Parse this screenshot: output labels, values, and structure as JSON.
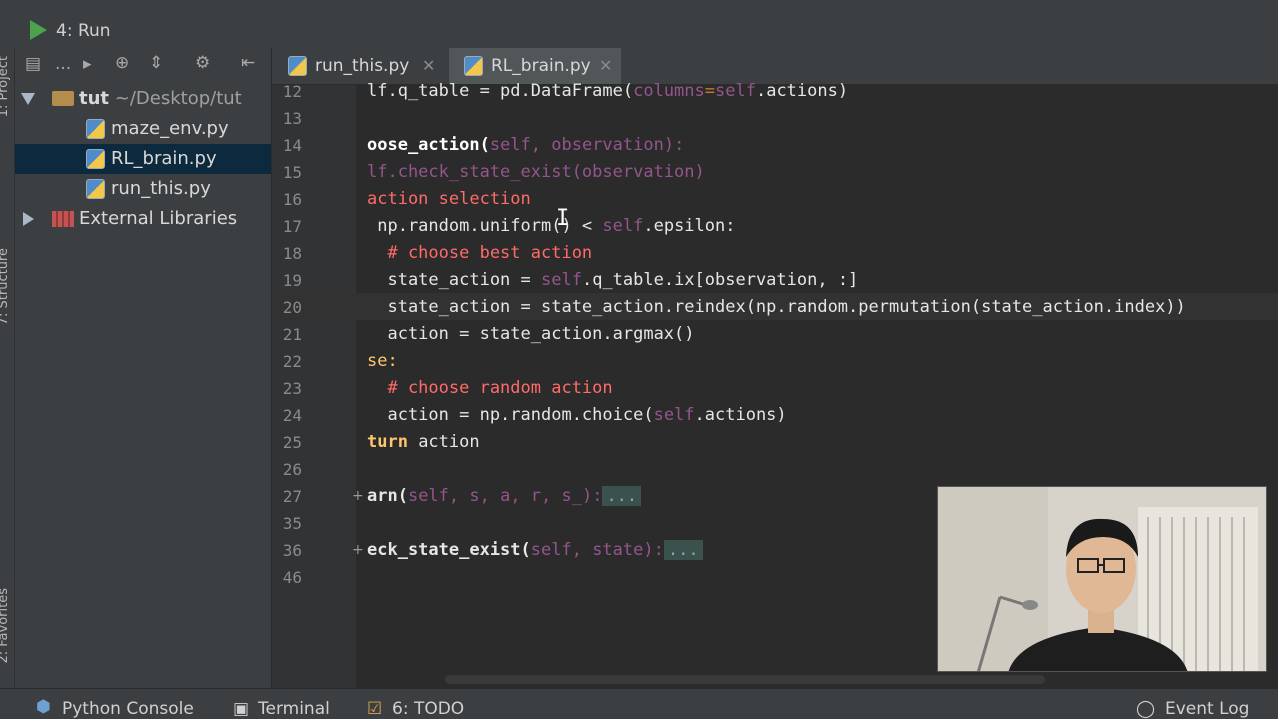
{
  "run_toolbar": {
    "label": "4: Run"
  },
  "side_strip": {
    "project_label": "1: Project",
    "structure_label": "7: Structure",
    "favorites_label": "2: Favorites"
  },
  "project_panel": {
    "toolbar_dots": "...",
    "tree": [
      {
        "name": "tut",
        "path": "~/Desktop/tut"
      },
      {
        "name": "maze_env.py"
      },
      {
        "name": "RL_brain.py"
      },
      {
        "name": "run_this.py"
      },
      {
        "name": "External Libraries"
      }
    ]
  },
  "tabs": [
    {
      "label": "run_this.py",
      "active": false
    },
    {
      "label": "RL_brain.py",
      "active": true
    }
  ],
  "editor": {
    "line_numbers": [
      "12",
      "13",
      "14",
      "15",
      "16",
      "17",
      "18",
      "19",
      "20",
      "21",
      "22",
      "23",
      "24",
      "25",
      "26",
      "27",
      "35",
      "36",
      "46"
    ],
    "lines": {
      "l12_a": "lf.q_table = pd.DataFrame(",
      "l12_b": "columns",
      "l12_c": "=",
      "l12_d": "self",
      "l12_e": ".actions)",
      "l14_a": "oose_action(",
      "l14_b": "self",
      "l14_c": ", observation):",
      "l15": "lf.check_state_exist(observation)",
      "l16": "action selection",
      "l17_a": " np.random.uniform() < ",
      "l17_b": "self",
      "l17_c": ".epsilon:",
      "l18": "  # choose best action",
      "l19_a": "  state_action = ",
      "l19_b": "self",
      "l19_c": ".q_table.ix[observation, :]",
      "l20": "  state_action = state_action.reindex(np.random.permutation(state_action.index))",
      "l21": "  action = state_action.argmax()",
      "l22": "se:",
      "l23": "  # choose random action",
      "l24_a": "  action = np.random.choice(",
      "l24_b": "self",
      "l24_c": ".actions)",
      "l25_a": "turn",
      "l25_b": " action",
      "l27_a": "arn(",
      "l27_b": "self",
      "l27_c": ", s, a, r, s_):",
      "l36_a": "eck_state_exist(",
      "l36_b": "self",
      "l36_c": ", state):",
      "collapsed_text": "..."
    }
  },
  "bottom_bar": {
    "python_console": "Python Console",
    "terminal": "Terminal",
    "todo": "6: TODO",
    "event_log": "Event Log"
  }
}
